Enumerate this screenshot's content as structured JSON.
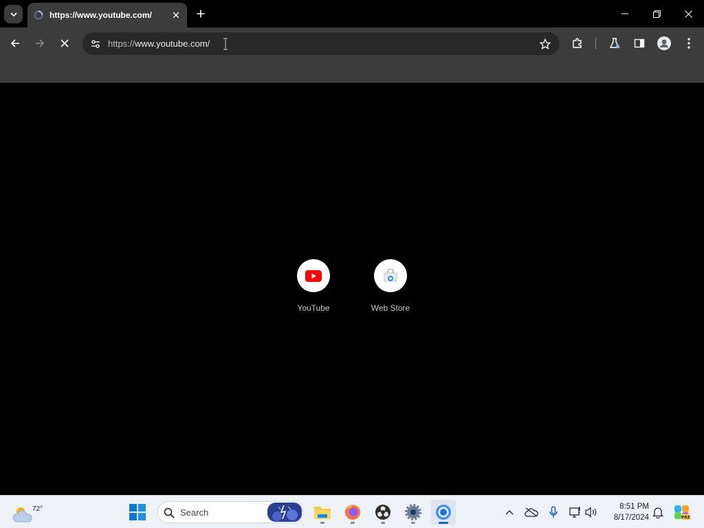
{
  "browser": {
    "tab": {
      "title": "https://www.youtube.com/"
    },
    "url_scheme": "https://",
    "url_host": "www.youtube.com/"
  },
  "shortcuts": [
    {
      "label": "YouTube",
      "icon": "youtube-icon"
    },
    {
      "label": "Web Store",
      "icon": "web-store-icon"
    }
  ],
  "taskbar": {
    "weather_temp": "72°",
    "search_placeholder": "Search",
    "time": "8:51 PM",
    "date": "8/17/2024",
    "apps": [
      "start-icon",
      "search-icon",
      "file-explorer-icon",
      "firefox-icon",
      "obs-icon",
      "settings-icon",
      "chrome-icon"
    ]
  },
  "colors": {
    "toolbar_bg": "#3c3c3c",
    "youtube_red": "#ff0000",
    "taskbar_accent": "#0067c0"
  }
}
